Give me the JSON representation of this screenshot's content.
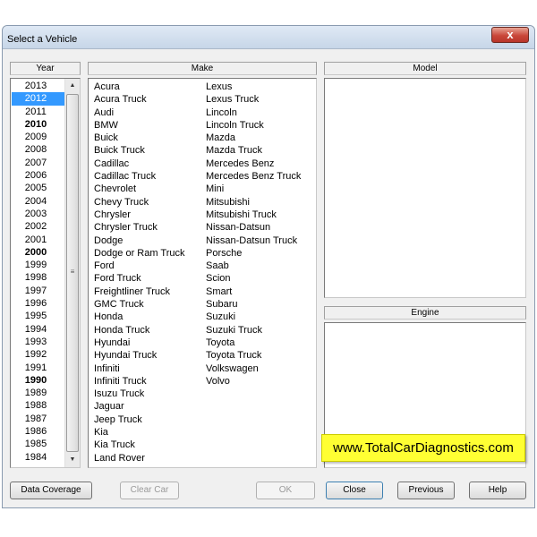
{
  "window": {
    "title": "Select a Vehicle",
    "close_glyph": "x"
  },
  "columns": {
    "year": "Year",
    "make": "Make",
    "model": "Model",
    "engine": "Engine"
  },
  "years": [
    {
      "label": "2013",
      "bold": false,
      "selected": false
    },
    {
      "label": "2012",
      "bold": false,
      "selected": true
    },
    {
      "label": "2011",
      "bold": false,
      "selected": false
    },
    {
      "label": "2010",
      "bold": true,
      "selected": false
    },
    {
      "label": "2009",
      "bold": false,
      "selected": false
    },
    {
      "label": "2008",
      "bold": false,
      "selected": false
    },
    {
      "label": "2007",
      "bold": false,
      "selected": false
    },
    {
      "label": "2006",
      "bold": false,
      "selected": false
    },
    {
      "label": "2005",
      "bold": false,
      "selected": false
    },
    {
      "label": "2004",
      "bold": false,
      "selected": false
    },
    {
      "label": "2003",
      "bold": false,
      "selected": false
    },
    {
      "label": "2002",
      "bold": false,
      "selected": false
    },
    {
      "label": "2001",
      "bold": false,
      "selected": false
    },
    {
      "label": "2000",
      "bold": true,
      "selected": false
    },
    {
      "label": "1999",
      "bold": false,
      "selected": false
    },
    {
      "label": "1998",
      "bold": false,
      "selected": false
    },
    {
      "label": "1997",
      "bold": false,
      "selected": false
    },
    {
      "label": "1996",
      "bold": false,
      "selected": false
    },
    {
      "label": "1995",
      "bold": false,
      "selected": false
    },
    {
      "label": "1994",
      "bold": false,
      "selected": false
    },
    {
      "label": "1993",
      "bold": false,
      "selected": false
    },
    {
      "label": "1992",
      "bold": false,
      "selected": false
    },
    {
      "label": "1991",
      "bold": false,
      "selected": false
    },
    {
      "label": "1990",
      "bold": true,
      "selected": false
    },
    {
      "label": "1989",
      "bold": false,
      "selected": false
    },
    {
      "label": "1988",
      "bold": false,
      "selected": false
    },
    {
      "label": "1987",
      "bold": false,
      "selected": false
    },
    {
      "label": "1986",
      "bold": false,
      "selected": false
    },
    {
      "label": "1985",
      "bold": false,
      "selected": false
    },
    {
      "label": "1984",
      "bold": false,
      "selected": false
    }
  ],
  "makes_col1": [
    "Acura",
    "Acura Truck",
    "Audi",
    "BMW",
    "Buick",
    "Buick Truck",
    "Cadillac",
    "Cadillac Truck",
    "Chevrolet",
    "Chevy Truck",
    "Chrysler",
    "Chrysler Truck",
    "Dodge",
    "Dodge or Ram Truck",
    "Ford",
    "Ford Truck",
    "Freightliner Truck",
    "GMC Truck",
    "Honda",
    "Honda Truck",
    "Hyundai",
    "Hyundai Truck",
    "Infiniti",
    "Infiniti Truck",
    "Isuzu Truck",
    "Jaguar",
    "Jeep Truck",
    "Kia",
    "Kia Truck",
    "Land Rover"
  ],
  "makes_col2": [
    "Lexus",
    "Lexus Truck",
    "Lincoln",
    "Lincoln Truck",
    "Mazda",
    "Mazda Truck",
    "Mercedes Benz",
    "Mercedes Benz Truck",
    "Mini",
    "Mitsubishi",
    "Mitsubishi Truck",
    "Nissan-Datsun",
    "Nissan-Datsun Truck",
    "Porsche",
    "Saab",
    "Scion",
    "Smart",
    "Subaru",
    "Suzuki",
    "Suzuki Truck",
    "Toyota",
    "Toyota Truck",
    "Volkswagen",
    "Volvo"
  ],
  "banner": "www.TotalCarDiagnostics.com",
  "buttons": {
    "data_coverage": "Data Coverage",
    "clear_car": "Clear Car",
    "ok": "OK",
    "close": "Close",
    "previous": "Previous",
    "help": "Help"
  },
  "scroll": {
    "up": "▲",
    "down": "▼",
    "grip": "≡"
  },
  "colors": {
    "selection": "#3399ff",
    "banner": "#ffff33"
  }
}
